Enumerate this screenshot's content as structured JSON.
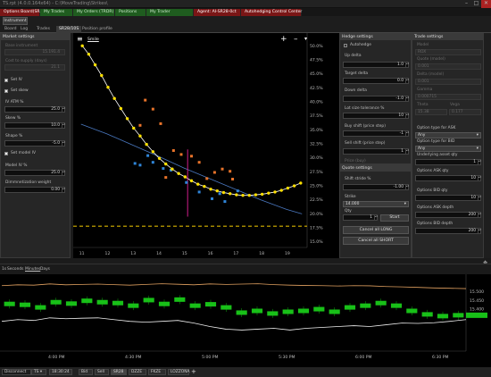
{
  "window": {
    "title": "TS.rpt (4.0.0.164x64) - C:\\MoveTrading\\Strikes\\",
    "min": "–",
    "max": "□",
    "close": "✕"
  },
  "app_tabs": [
    {
      "label": "Options Board(SR28)",
      "bg": "#7a1616",
      "color": "#ffffff"
    },
    {
      "label": "My Trades",
      "bg": "#1f5c1f",
      "color": "#c9e8c9"
    },
    {
      "label": "My Orders (TRDR)",
      "bg": "#1f5c1f",
      "color": "#c9e8c9"
    },
    {
      "label": "Positions",
      "bg": "#1f5c1f",
      "color": "#c9e8c9"
    },
    {
      "label": "My Trader",
      "bg": "#1f5c1f",
      "color": "#c9e8c9"
    },
    {
      "label": "Agent: AI-SR28-0ct",
      "bg": "#7a1616",
      "color": "#ffffff"
    },
    {
      "label": "Autohedging Control Center",
      "bg": "#7a1616",
      "color": "#ffffff"
    }
  ],
  "toolbar": {
    "instrument_button": "Instrument"
  },
  "sub_tabs": [
    "Board",
    "Log",
    "Trades",
    "SR28/10S",
    "Position profile"
  ],
  "market": {
    "header": "Market settings",
    "disabled_fields": [
      {
        "label": "Base instrument",
        "value": "15.191.4"
      },
      {
        "label": "Cost to supply (days)",
        "value": "21.1"
      }
    ],
    "set_iv": "Set IV",
    "set_skew": "Set skew",
    "iv_atm": {
      "label": "IV ATM %",
      "value": "25.0"
    },
    "skew": {
      "label": "Skew %",
      "value": "10.0"
    },
    "shape": {
      "label": "Shape %",
      "value": "-5.0"
    },
    "set_model_iv": "Set model IV",
    "model_iv": {
      "label": "Model IV %",
      "value": "25.0"
    },
    "dim_weight": {
      "label": "Dimmnetization weight",
      "value": "0.00"
    }
  },
  "smile_chart": {
    "smile_label": "Smile",
    "menu_icon": "hamburger-menu-icon",
    "plus": "+",
    "minus": "–",
    "dropdown": "▾",
    "x_ticks": [
      "11",
      "12",
      "13",
      "14",
      "15",
      "16",
      "17",
      "18",
      "19"
    ],
    "y_ticks": [
      "50.0%",
      "47.5%",
      "45.0%",
      "42.5%",
      "40.0%",
      "37.5%",
      "35.0%",
      "32.5%",
      "30.0%",
      "27.5%",
      "25.0%",
      "22.5%",
      "20.0%",
      "17.5%",
      "15.0%"
    ]
  },
  "chart_data": [
    {
      "type": "scatter",
      "title": "Smile",
      "xlim": [
        10.8,
        19.8
      ],
      "ylim": [
        14,
        51
      ],
      "series": [
        {
          "role": "smile-points",
          "color": "#ffe000",
          "x": [
            11.05,
            11.3,
            11.55,
            11.8,
            12.05,
            12.3,
            12.55,
            12.8,
            13.05,
            13.3,
            13.55,
            13.8,
            14.05,
            14.3,
            14.55,
            14.8,
            15.05,
            15.3,
            15.55,
            15.8,
            16.05,
            16.3,
            16.55,
            16.8,
            17.05,
            17.3,
            17.55,
            17.8,
            18.05,
            18.3,
            18.55,
            18.8,
            19.05,
            19.3,
            19.55
          ],
          "y": [
            50,
            48.5,
            46.6,
            44.7,
            42.6,
            40.6,
            38.8,
            37,
            35.3,
            33.9,
            32.4,
            31.1,
            29.9,
            28.9,
            28,
            27.2,
            26.6,
            25.9,
            25.3,
            24.9,
            24.4,
            24.1,
            23.8,
            23.6,
            23.4,
            23.3,
            23.3,
            23.4,
            23.5,
            23.7,
            23.9,
            24.2,
            24.6,
            25,
            25.5
          ]
        },
        {
          "role": "ask-points",
          "color": "#e8732a",
          "x": [
            13.5,
            13.8,
            14.1,
            13.3,
            14.6,
            14.9,
            15.3,
            15.6,
            16.2,
            16.5,
            16.8,
            14.3,
            15.9,
            16.9
          ],
          "y": [
            40.3,
            38.7,
            36.1,
            35.8,
            31.3,
            30.6,
            30.3,
            29.2,
            27.4,
            28.0,
            27.6,
            26.5,
            26.3,
            26.2
          ]
        },
        {
          "role": "bid-points",
          "color": "#2f85d8",
          "x": [
            13.1,
            13.3,
            13.6,
            13.8,
            14.2,
            14.5,
            15.1,
            15.6,
            16.1,
            16.4,
            16.6,
            17.1
          ],
          "y": [
            29.0,
            28.7,
            30.4,
            29.2,
            28.1,
            27.8,
            25.6,
            23.9,
            22.7,
            23.6,
            22.2,
            24.1
          ]
        },
        {
          "role": "model-curve",
          "color": "#4a78c0",
          "x": [
            11,
            12,
            13,
            14,
            15,
            16,
            17,
            18,
            19,
            19.6
          ],
          "y": [
            36,
            34.3,
            32.3,
            30.3,
            28.2,
            26.3,
            24.4,
            22.5,
            20.8,
            20
          ]
        },
        {
          "role": "atm-bid-ask",
          "color": "#d11e8a",
          "x": [
            15.15,
            15.15
          ],
          "y": [
            19.5,
            31.5
          ]
        }
      ],
      "reference_line": {
        "y": 17.8,
        "color": "#d8b400",
        "style": "dashed"
      }
    },
    {
      "type": "line",
      "title": "Price",
      "ylim": [
        15.2,
        15.58
      ],
      "x_ticks": [
        "4:00 PM",
        "4:30 PM",
        "5:00 PM",
        "5:30 PM",
        "6:00 PM",
        "6:30 PM"
      ],
      "y_ticks": [
        "15.500",
        "15.450",
        "15.400"
      ],
      "series": [
        {
          "role": "upper-band",
          "color": "#e0a060",
          "values": [
            15.535,
            15.54,
            15.538,
            15.545,
            15.54,
            15.542,
            15.544,
            15.541,
            15.538,
            15.542,
            15.546,
            15.543,
            15.54,
            15.545,
            15.542,
            15.544,
            15.546,
            15.541,
            15.538,
            15.536,
            15.535,
            15.533,
            15.535,
            15.534,
            15.53,
            15.528,
            15.525,
            15.522,
            15.52,
            15.518
          ]
        },
        {
          "role": "price-candles",
          "color": "#18c018",
          "values": [
            15.43,
            15.425,
            15.41,
            15.44,
            15.432,
            15.448,
            15.44,
            15.435,
            15.42,
            15.452,
            15.43,
            15.455,
            15.42,
            15.428,
            15.41,
            15.38,
            15.39,
            15.375,
            15.385,
            15.39,
            15.4,
            15.385,
            15.41,
            15.42,
            15.435,
            15.42,
            15.39,
            15.37,
            15.36,
            15.365
          ]
        },
        {
          "role": "lower-band",
          "color": "#f0f0f0",
          "values": [
            15.33,
            15.34,
            15.335,
            15.35,
            15.345,
            15.348,
            15.35,
            15.34,
            15.33,
            15.325,
            15.33,
            15.335,
            15.32,
            15.3,
            15.285,
            15.28,
            15.285,
            15.29,
            15.28,
            15.29,
            15.295,
            15.3,
            15.305,
            15.3,
            15.31,
            15.32,
            15.318,
            15.322,
            15.33,
            15.34
          ]
        }
      ]
    }
  ],
  "hedge": {
    "header": "Hedge settings",
    "autohedge": "Autohedge",
    "up_delta": {
      "label": "Up delta",
      "value": "1.0"
    },
    "target_delta": {
      "label": "Target delta",
      "value": "0.0"
    },
    "down_delta": {
      "label": "Down delta",
      "value": "-1.0"
    },
    "lot_size": {
      "label": "Lot size tolerance %",
      "value": "10"
    },
    "buy_shift": {
      "label": "Buy shift (price step)",
      "value": "-1"
    },
    "sell_shift": {
      "label": "Sell shift (price step)",
      "value": "1"
    },
    "price_buy": "Price (buy)"
  },
  "quote": {
    "header": "Quote settings",
    "shift_stride": {
      "label": "Shift stride %",
      "value": "-1.00"
    },
    "strike": {
      "label": "Strike",
      "value": "14.000"
    },
    "qty": {
      "label": "Qty",
      "value": "1"
    },
    "start": "Start",
    "cancel_long": "Cancel all LONG",
    "cancel_short": "Cancel all SHORT"
  },
  "trade": {
    "header": "Trade settings",
    "disabled": [
      {
        "label": "Model",
        "value": "ROX"
      },
      {
        "label": "Quote (model)",
        "value": "0.001"
      },
      {
        "label": "Delta (model)",
        "value": "0.001"
      },
      {
        "label": "Gamma",
        "value": "0.000715"
      }
    ],
    "theta_label": "Theta",
    "vega_label": "Vega",
    "theta": "15.38",
    "vega": "0.177",
    "ask_type": {
      "label": "Option type for ASK",
      "value": "Any"
    },
    "bid_type": {
      "label": "Option type for BID",
      "value": "Any"
    },
    "underlying": {
      "label": "Underlying asset qty",
      "value": "1"
    },
    "ask_qty": {
      "label": "Options ASK qty",
      "value": "10"
    },
    "bid_qty": {
      "label": "Options BID qty",
      "value": "10"
    },
    "ask_depth": {
      "label": "Options ASK depth",
      "value": "200"
    },
    "bid_depth": {
      "label": "Options BID depth",
      "value": "200"
    }
  },
  "price_chart": {
    "periods": [
      "1s",
      "Seconds",
      "Minutes",
      "Days"
    ]
  },
  "status": {
    "connection": "Disconnect",
    "ts": "TS ▾",
    "time": "18:30:24",
    "fields": [
      "Bid",
      "Sell",
      "SR28",
      "DZZE",
      "FKZE",
      "LOZZONA"
    ],
    "add": "+"
  }
}
